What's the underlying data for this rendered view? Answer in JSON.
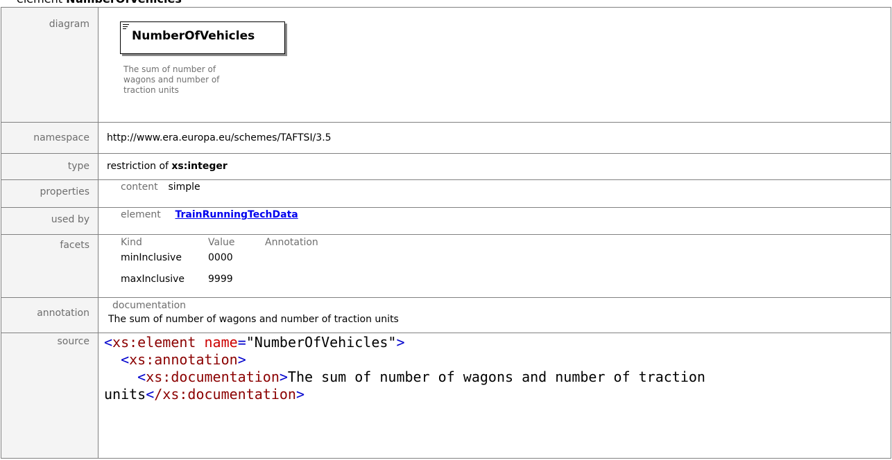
{
  "heading": {
    "prefix": "element ",
    "name": "NumberOfVehicles"
  },
  "labels": {
    "diagram": "diagram",
    "namespace": "namespace",
    "type": "type",
    "properties": "properties",
    "used_by": "used by",
    "facets": "facets",
    "annotation": "annotation",
    "source": "source"
  },
  "diagram": {
    "element_name": "NumberOfVehicles",
    "documentation": "The sum of number of wagons and number of traction units"
  },
  "namespace": "http://www.era.europa.eu/schemes/TAFTSI/3.5",
  "type": {
    "prefix": "restriction of ",
    "base": "xs:integer"
  },
  "properties": {
    "key": "content",
    "value": "simple"
  },
  "used_by": {
    "kind": "element",
    "link": "TrainRunningTechData"
  },
  "facets": {
    "headers": [
      "Kind",
      "Value",
      "Annotation"
    ],
    "rows": [
      {
        "kind": "minInclusive",
        "value": "0000"
      },
      {
        "kind": "maxInclusive",
        "value": "9999"
      }
    ]
  },
  "annotation": {
    "key": "documentation",
    "text": "The sum of number of wagons and number of traction units"
  },
  "source": {
    "line1_tag": "xs:element",
    "line1_attr": "name",
    "line1_value": "\"NumberOfVehicles\"",
    "line2_tag": "xs:annotation",
    "line3_tag": "xs:documentation",
    "line3_text": "The sum of number of wagons and number of traction",
    "line4_text": "units",
    "line4_close": "/xs:documentation"
  }
}
